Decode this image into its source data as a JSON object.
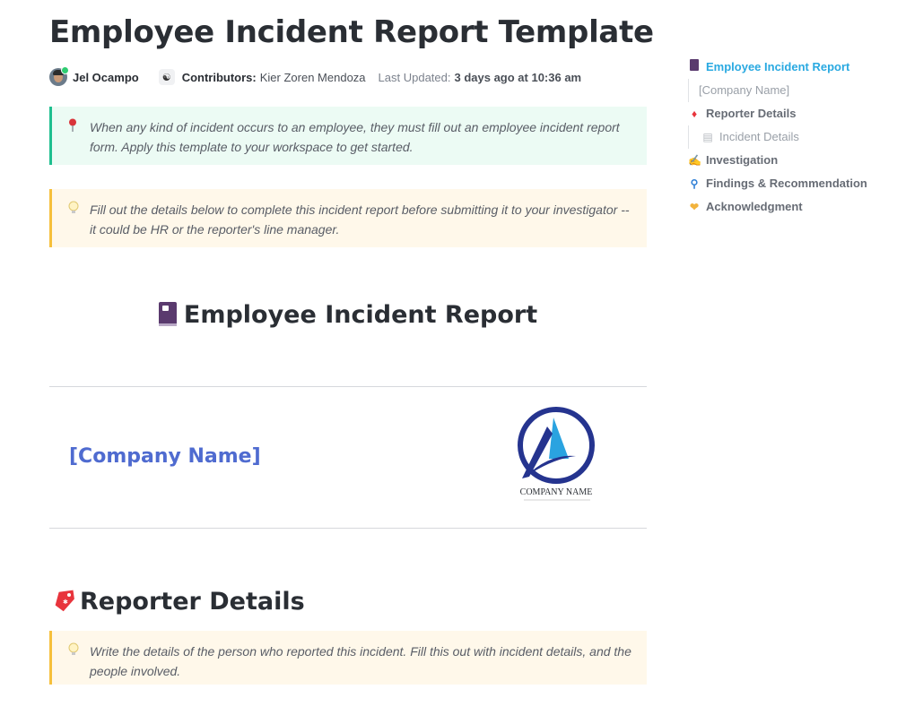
{
  "page": {
    "title": "Employee Incident Report Template"
  },
  "meta": {
    "author": "Jel Ocampo",
    "contributors_label": "Contributors:",
    "contributors": "Kier Zoren Mendoza",
    "last_updated_label": "Last Updated:",
    "last_updated": "3 days ago at 10:36 am"
  },
  "callouts": [
    {
      "icon": "pin-icon",
      "text": "When any kind of incident occurs to an employee, they must fill out an employee incident report form. Apply this template to your workspace to get started."
    },
    {
      "icon": "lightbulb-icon",
      "text": "Fill out the details below to complete this incident report before submitting it to your investigator -- it could be HR or the reporter's line manager."
    },
    {
      "icon": "lightbulb-icon",
      "text": "Write the details of the person who reported this incident. Fill this out with incident details, and the people involved."
    }
  ],
  "sections": {
    "report_heading": "Employee Incident Report",
    "company_name": "[Company Name]",
    "logo_text": "COMPANY NAME",
    "reporter_heading": "Reporter Details"
  },
  "toc": {
    "items": [
      {
        "label": "Employee Incident Report",
        "icon": "book-icon",
        "active": true
      },
      {
        "label": "[Company Name]",
        "icon": "",
        "active": false
      },
      {
        "label": "Reporter Details",
        "icon": "tag-icon",
        "active": false
      },
      {
        "label": "Incident Details",
        "icon": "document-icon",
        "active": false
      },
      {
        "label": "Investigation",
        "icon": "writing-hand-icon",
        "active": false
      },
      {
        "label": "Findings & Recommendation",
        "icon": "magnifier-icon",
        "active": false
      },
      {
        "label": "Acknowledgment",
        "icon": "handshake-icon",
        "active": false
      }
    ]
  },
  "colors": {
    "accent": "#29a9e1",
    "company_link": "#4f6bd0",
    "callout_green_border": "#1fbf8f",
    "callout_yellow_border": "#f6c03b"
  }
}
